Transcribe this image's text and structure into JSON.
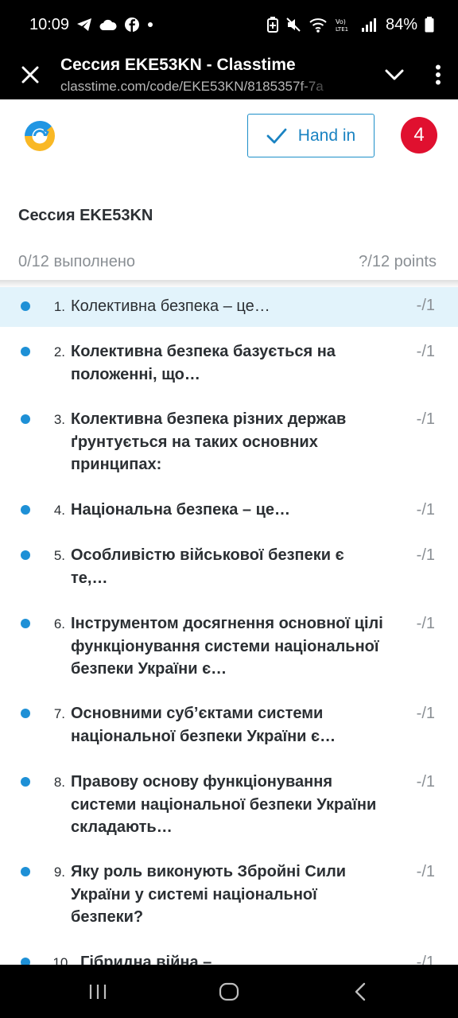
{
  "status": {
    "time": "10:09",
    "battery": "84%",
    "left_icons": [
      "telegram-icon",
      "cloud-icon",
      "facebook-icon",
      "dot-icon"
    ],
    "right_icons": [
      "battery-saver-icon",
      "mute-icon",
      "wifi-icon",
      "volte-icon",
      "signal-icon",
      "battery-icon"
    ]
  },
  "browser": {
    "title": "Сессия EKE53KN - Classtime",
    "url": "classtime.com/code/EKE53KN/8185357f-7a"
  },
  "header": {
    "hand_in_label": "Hand in",
    "badge_count": "4",
    "accent_color": "#1a83c2",
    "badge_color": "#e0102f"
  },
  "session": {
    "title": "Сессия EKE53KN",
    "progress": "0/12 выполнено",
    "points": "?/12 points"
  },
  "questions": [
    {
      "num": "1.",
      "text": "Колективна безпека – це…",
      "score": "-/1"
    },
    {
      "num": "2.",
      "text": "Колективна безпека базується на положенні, що…",
      "score": "-/1"
    },
    {
      "num": "3.",
      "text": "Колективна безпека різних держав ґрунтується на таких основних принципах:",
      "score": "-/1"
    },
    {
      "num": "4.",
      "text": "Національна безпека – це…",
      "score": "-/1"
    },
    {
      "num": "5.",
      "text": "Особливістю військової безпеки є те,…",
      "score": "-/1"
    },
    {
      "num": "6.",
      "text": "Інструментом досягнення основної цілі функціонування системи національної безпеки України є…",
      "score": "-/1"
    },
    {
      "num": "7.",
      "text": "Основними суб’єктами системи національної безпеки України є…",
      "score": "-/1"
    },
    {
      "num": "8.",
      "text": "Правову основу функціонування системи національної безпеки України складають…",
      "score": "-/1"
    },
    {
      "num": "9.",
      "text": "Яку роль виконують Збройні Сили України у системі національної безпеки?",
      "score": "-/1"
    },
    {
      "num": "10.",
      "text": "Гібридна війна –",
      "score": "-/1"
    }
  ]
}
